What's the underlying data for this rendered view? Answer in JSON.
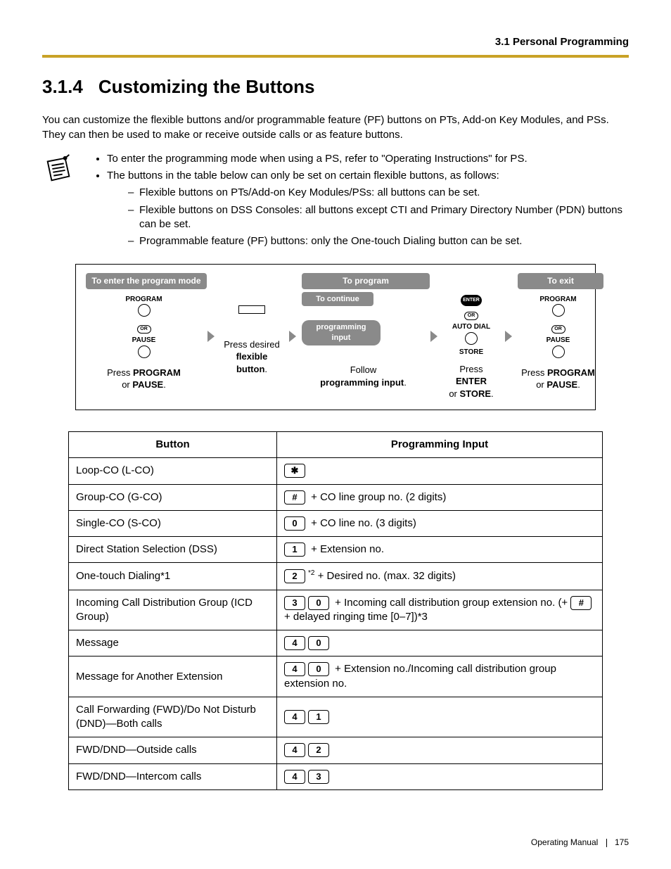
{
  "header": {
    "section": "3.1 Personal Programming"
  },
  "title": {
    "number": "3.1.4",
    "text": "Customizing the Buttons"
  },
  "intro": "You can customize the flexible buttons and/or programmable feature (PF) buttons on PTs, Add-on Key Modules, and PSs. They can then be used to make or receive outside calls or as feature buttons.",
  "notes": {
    "b1": "To enter the programming mode when using a PS, refer to \"Operating Instructions\" for PS.",
    "b2": "The buttons in the table below can only be set on certain flexible buttons, as follows:",
    "s1": "Flexible buttons on PTs/Add-on Key Modules/PSs: all buttons can be set.",
    "s2": "Flexible buttons on DSS Consoles: all buttons except CTI and Primary Directory Number (PDN) buttons can be set.",
    "s3": "Programmable feature (PF) buttons: only the One-touch Dialing button can be set."
  },
  "diagram": {
    "enter": "To enter the program mode",
    "program": "To program",
    "exit": "To exit",
    "continue": "To continue",
    "proginput": "programming input",
    "labels": {
      "program": "PROGRAM",
      "or": "OR",
      "pause": "PAUSE",
      "enter": "ENTER",
      "autodial": "AUTO DIAL",
      "store": "STORE"
    },
    "cap1a": "Press ",
    "cap1b": "PROGRAM",
    "cap1c": " or ",
    "cap1d": "PAUSE",
    "cap1e": ".",
    "cap2a": "Press desired ",
    "cap2b": "flexible button",
    "cap2c": ".",
    "cap3a": "Follow ",
    "cap3b": "programming input",
    "cap3c": ".",
    "cap4a": "Press ",
    "cap4b": "ENTER",
    "cap4c": " or ",
    "cap4d": "STORE",
    "cap4e": ".",
    "cap5a": "Press ",
    "cap5b": "PROGRAM",
    "cap5c": " or ",
    "cap5d": "PAUSE",
    "cap5e": "."
  },
  "table": {
    "h1": "Button",
    "h2": "Programming Input",
    "rows": [
      {
        "button": "Loop-CO (L-CO)",
        "keys": [
          "✱"
        ],
        "suffix": ""
      },
      {
        "button": "Group-CO (G-CO)",
        "keys": [
          "#"
        ],
        "suffix": " + CO line group no. (2 digits)"
      },
      {
        "button": "Single-CO (S-CO)",
        "keys": [
          "0"
        ],
        "suffix": " + CO line no. (3 digits)"
      },
      {
        "button": "Direct Station Selection (DSS)",
        "keys": [
          "1"
        ],
        "suffix": " + Extension no."
      },
      {
        "button": "One-touch Dialing*1",
        "keys": [
          "2"
        ],
        "sup": "*2",
        "suffix": " + Desired no. (max. 32 digits)"
      },
      {
        "button": "Incoming Call Distribution Group (ICD Group)",
        "keys": [
          "3",
          "0"
        ],
        "suffix": " + Incoming call distribution group extension no. (+ ",
        "trailkey": "#",
        "suffix2": " + delayed ringing time [0–7])*3"
      },
      {
        "button": "Message",
        "keys": [
          "4",
          "0"
        ],
        "suffix": ""
      },
      {
        "button": "Message for Another Extension",
        "keys": [
          "4",
          "0"
        ],
        "suffix": " + Extension no./Incoming call distribution group extension no."
      },
      {
        "button": "Call Forwarding (FWD)/Do Not Disturb (DND)—Both calls",
        "keys": [
          "4",
          "1"
        ],
        "suffix": ""
      },
      {
        "button": "FWD/DND—Outside calls",
        "keys": [
          "4",
          "2"
        ],
        "suffix": ""
      },
      {
        "button": "FWD/DND—Intercom calls",
        "keys": [
          "4",
          "3"
        ],
        "suffix": ""
      }
    ]
  },
  "footer": {
    "manual": "Operating Manual",
    "page": "175"
  }
}
